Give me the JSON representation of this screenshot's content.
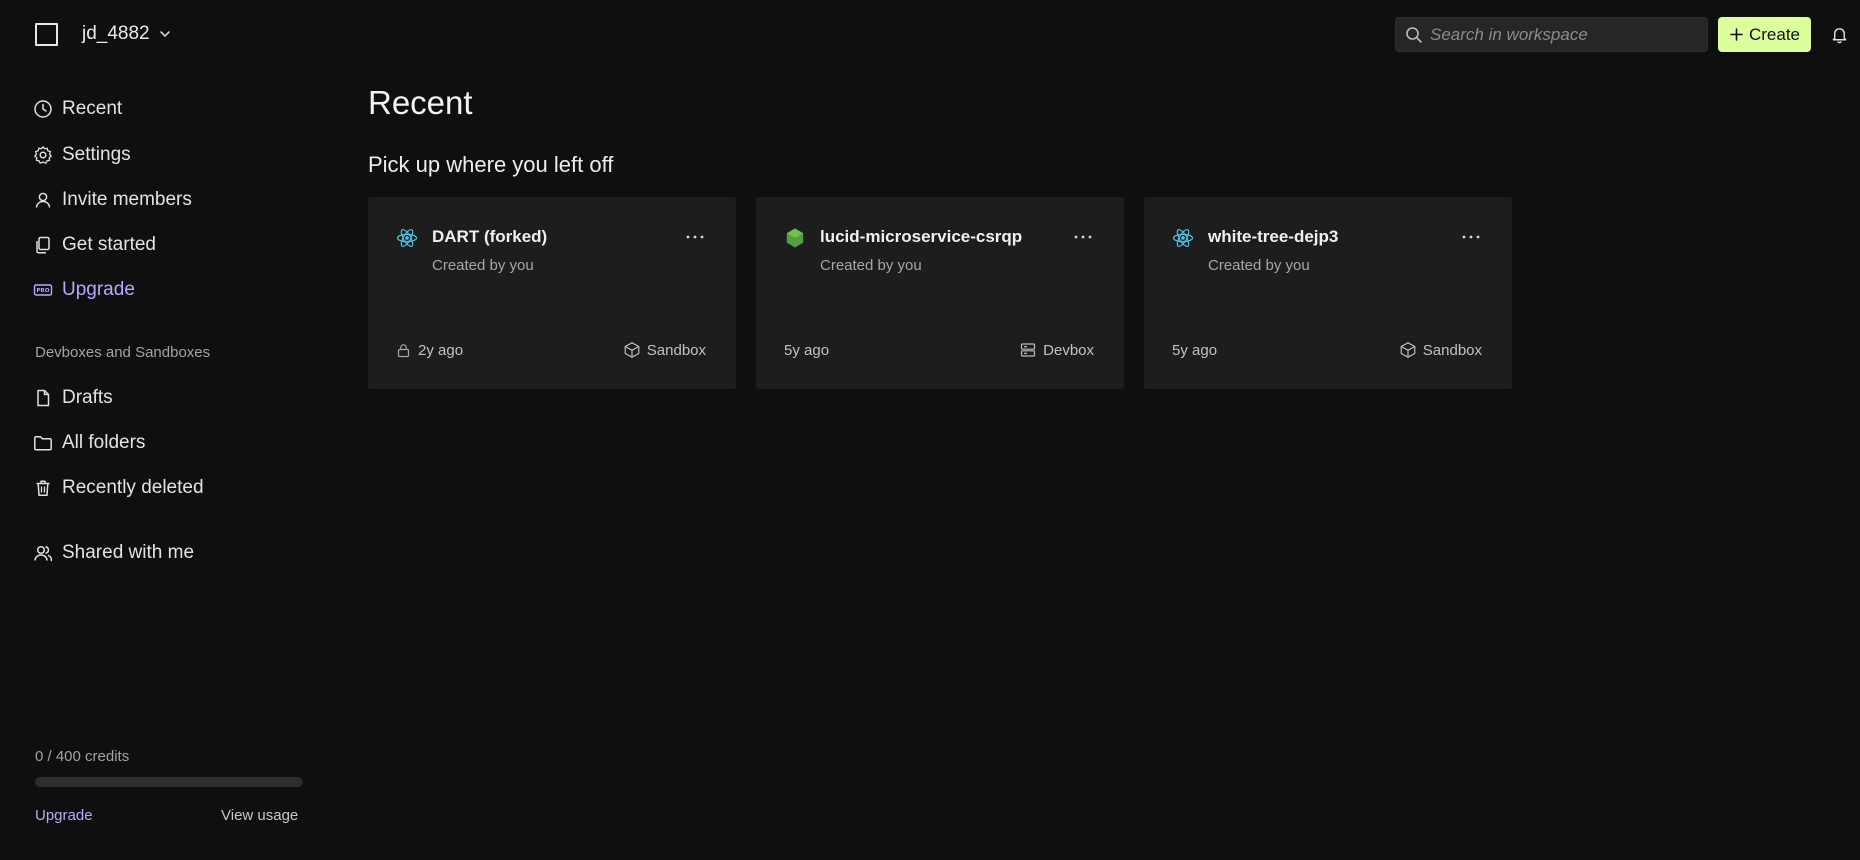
{
  "header": {
    "workspace_name": "jd_4882",
    "search_placeholder": "Search in workspace",
    "create_label": "Create"
  },
  "sidebar": {
    "items": [
      {
        "label": "Recent",
        "icon": "clock-icon"
      },
      {
        "label": "Settings",
        "icon": "gear-icon"
      },
      {
        "label": "Invite members",
        "icon": "user-icon"
      },
      {
        "label": "Get started",
        "icon": "copy-icon"
      },
      {
        "label": "Upgrade",
        "icon": "pro-badge-icon"
      }
    ],
    "section_label": "Devboxes and Sandboxes",
    "section_items": [
      {
        "label": "Drafts",
        "icon": "file-icon"
      },
      {
        "label": "All folders",
        "icon": "folder-icon"
      },
      {
        "label": "Recently deleted",
        "icon": "trash-icon"
      }
    ],
    "shared_label": "Shared with me",
    "credits": {
      "text": "0 / 400 credits",
      "used": 0,
      "total": 400
    },
    "footer_upgrade": "Upgrade",
    "footer_usage": "View usage"
  },
  "main": {
    "title": "Recent",
    "subtitle": "Pick up where you left off",
    "cards": [
      {
        "title": "DART (forked)",
        "subtitle": "Created by you",
        "time": "2y ago",
        "type": "Sandbox",
        "icon": "react-icon",
        "locked": true
      },
      {
        "title": "lucid-microservice-csrqp",
        "subtitle": "Created by you",
        "time": "5y ago",
        "type": "Devbox",
        "icon": "nodejs-icon",
        "locked": false
      },
      {
        "title": "white-tree-dejp3",
        "subtitle": "Created by you",
        "time": "5y ago",
        "type": "Sandbox",
        "icon": "react-icon",
        "locked": false
      }
    ]
  },
  "colors": {
    "background": "#0f0f0f",
    "card": "#1d1d1d",
    "accent_create": "#dcfe9c",
    "accent_upgrade": "#b9a8ff"
  }
}
